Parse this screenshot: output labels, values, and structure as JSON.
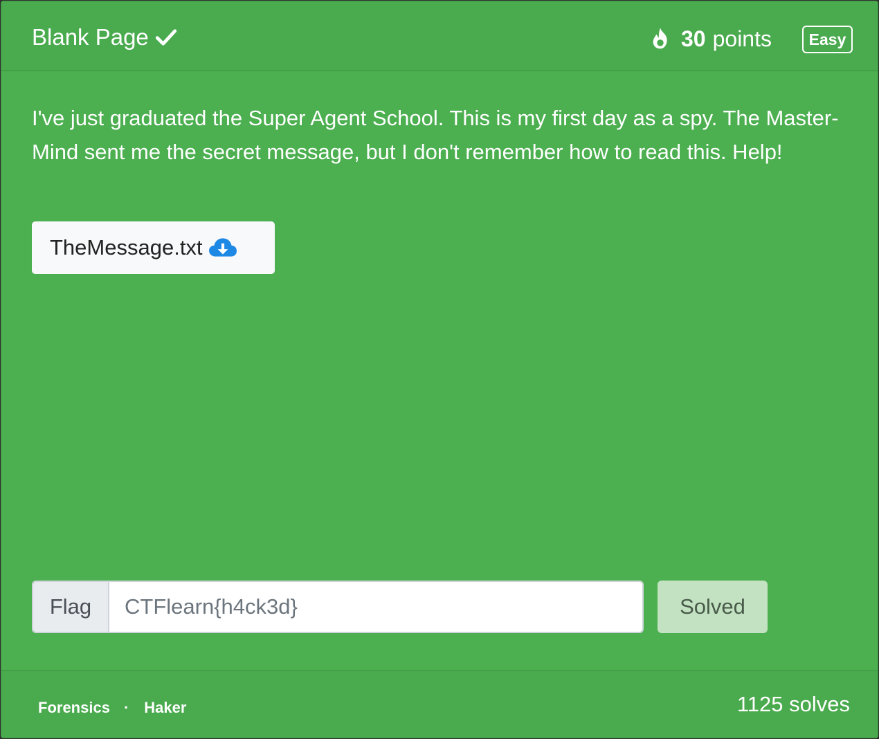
{
  "challenge": {
    "title": "Blank Page",
    "points_value": "30",
    "points_label": "points",
    "difficulty": "Easy",
    "description": "I've just graduated the Super Agent School. This is my first day as a spy. The Master-Mind sent me the secret message, but I don't remember how to read this. Help!",
    "download_label": "TheMessage.txt"
  },
  "flag_form": {
    "prefix_label": "Flag",
    "input_value": "CTFlearn{h4ck3d}",
    "button_label": "Solved"
  },
  "footer": {
    "category": "Forensics",
    "separator": "·",
    "author": "Haker",
    "solves": "1125 solves"
  },
  "icons": {
    "title": "check-icon",
    "points": "fire-icon",
    "download": "cloud-download-icon"
  },
  "colors": {
    "card_bg": "#4caf50",
    "download_icon": "#1e88e5",
    "solved_button_bg": "#c2e2c2"
  }
}
